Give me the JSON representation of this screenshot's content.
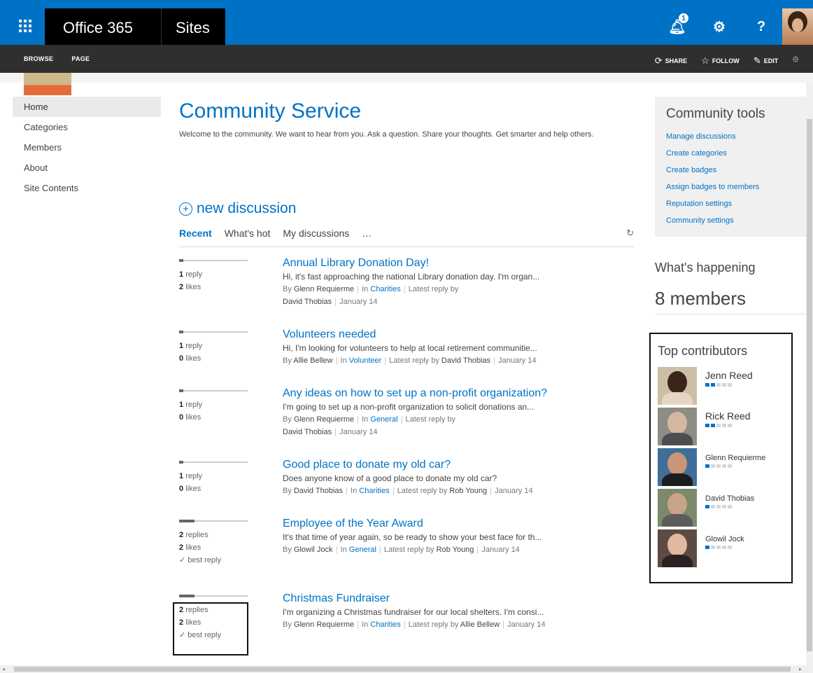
{
  "suitebar": {
    "app_name": "Office 365",
    "site_label": "Sites",
    "notification_count": "1",
    "settings_icon": "gear-icon",
    "help_label": "?",
    "brand_color": "#0072c6"
  },
  "ribbon": {
    "tabs": [
      "BROWSE",
      "PAGE"
    ],
    "share_label": "SHARE",
    "follow_label": "FOLLOW",
    "edit_label": "EDIT"
  },
  "leftnav": {
    "items": [
      "Home",
      "Categories",
      "Members",
      "About",
      "Site Contents"
    ]
  },
  "main": {
    "title": "Community Service",
    "welcome": "Welcome to the community. We want to hear from you. Ask a question. Share your thoughts. Get smarter and help others.",
    "new_discussion": "new discussion",
    "tabs": [
      "Recent",
      "What's hot",
      "My discussions",
      "…"
    ],
    "discussions": [
      {
        "replies_count": "1",
        "replies_label": "reply",
        "likes_count": "2",
        "likes_label": "likes",
        "best_reply": "",
        "title": "Annual Library Donation Day!",
        "text": "Hi, it's fast approaching the national Library donation day. I'm organ...",
        "by_prefix": "By",
        "author": "Glenn Requierme",
        "in_prefix": "In",
        "category": "Charities",
        "latest_prefix": "Latest reply by",
        "latest_author": "David Thobias",
        "date": "January 14"
      },
      {
        "replies_count": "1",
        "replies_label": "reply",
        "likes_count": "0",
        "likes_label": "likes",
        "best_reply": "",
        "title": "Volunteers needed",
        "text": "Hi, I'm looking for volunteers to help at local retirement communitie...",
        "by_prefix": "By",
        "author": "Allie Bellew",
        "in_prefix": "In",
        "category": "Volunteer",
        "latest_prefix": "Latest reply by",
        "latest_author": "David Thobias",
        "date": "January 14"
      },
      {
        "replies_count": "1",
        "replies_label": "reply",
        "likes_count": "0",
        "likes_label": "likes",
        "best_reply": "",
        "title": "Any ideas on how to set up a non-profit organization?",
        "text": "I'm going to set up a non-profit organization to solicit donations an...",
        "by_prefix": "By",
        "author": "Glenn Requierme",
        "in_prefix": "In",
        "category": "General",
        "latest_prefix": "Latest reply by",
        "latest_author": "David Thobias",
        "date": "January 14"
      },
      {
        "replies_count": "1",
        "replies_label": "reply",
        "likes_count": "0",
        "likes_label": "likes",
        "best_reply": "",
        "title": "Good place to donate my old car?",
        "text": "Does anyone know of a good place to donate my old car?",
        "by_prefix": "By",
        "author": "David Thobias",
        "in_prefix": "In",
        "category": "Charities",
        "latest_prefix": "Latest reply by",
        "latest_author": "Rob Young",
        "date": "January 14"
      },
      {
        "replies_count": "2",
        "replies_label": "replies",
        "likes_count": "2",
        "likes_label": "likes",
        "best_reply": "✓ best reply",
        "title": "Employee of the Year Award",
        "text": "It's that time of year again, so be ready to show your best face for th...",
        "by_prefix": "By",
        "author": "Glowil Jock",
        "in_prefix": "In",
        "category": "General",
        "latest_prefix": "Latest reply by",
        "latest_author": "Rob Young",
        "date": "January 14"
      },
      {
        "replies_count": "2",
        "replies_label": "replies",
        "likes_count": "2",
        "likes_label": "likes",
        "best_reply": "✓ best reply",
        "title": "Christmas Fundraiser",
        "text": "I'm organizing a Christmas fundraiser for our local shelters. I'm consi...",
        "by_prefix": "By",
        "author": "Glenn Requierme",
        "in_prefix": "In",
        "category": "Charities",
        "latest_prefix": "Latest reply by",
        "latest_author": "Allie Bellew",
        "date": "January 14"
      }
    ]
  },
  "tools": {
    "title": "Community tools",
    "links": [
      "Manage discussions",
      "Create categories",
      "Create badges",
      "Assign badges to members",
      "Reputation settings",
      "Community settings"
    ]
  },
  "happening": {
    "title": "What's happening",
    "members": "8 members"
  },
  "contributors": {
    "title": "Top contributors",
    "people": [
      {
        "name": "Jenn Reed",
        "level": 2
      },
      {
        "name": "Rick Reed",
        "level": 2
      },
      {
        "name": "Glenn Requierme",
        "level": 1
      },
      {
        "name": "David Thobias",
        "level": 1
      },
      {
        "name": "Glowil Jock",
        "level": 1
      }
    ]
  }
}
